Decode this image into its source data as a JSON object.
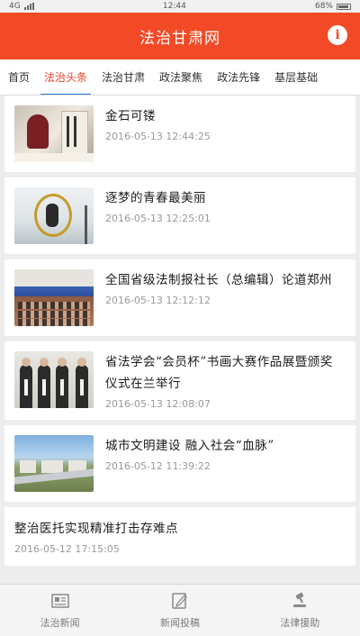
{
  "status_bar": {
    "network": "4G",
    "time": "12:44",
    "battery": "68%"
  },
  "header": {
    "title": "法治甘肃网",
    "info_icon": "info-icon",
    "info_label": "i",
    "background": "#f24a26"
  },
  "tabs": [
    {
      "label": "首页",
      "active": false
    },
    {
      "label": "法治头条",
      "active": true
    },
    {
      "label": "法治甘肃",
      "active": false
    },
    {
      "label": "政法聚焦",
      "active": false
    },
    {
      "label": "政法先锋",
      "active": false
    },
    {
      "label": "基层基础",
      "active": false
    }
  ],
  "news": [
    {
      "title": "金石可镂",
      "date": "2016-05-13 12:44:25",
      "has_image": true
    },
    {
      "title": "逐梦的青春最美丽",
      "date": "2016-05-13 12:25:01",
      "has_image": true
    },
    {
      "title": "全国省级法制报社长（总编辑）论道郑州",
      "date": "2016-05-13 12:12:12",
      "has_image": true
    },
    {
      "title": "省法学会“会员杯”书画大赛作品展暨颁奖仪式在兰举行",
      "date": "2016-05-13 12:08:07",
      "has_image": true
    },
    {
      "title": "城市文明建设 融入社会“血脉”",
      "date": "2016-05-12 11:39:22",
      "has_image": true
    },
    {
      "title": "整治医托实现精准打击存难点",
      "date": "2016-05-12 17:15:05",
      "has_image": false
    }
  ],
  "bottom_tabs": [
    {
      "label": "法治新闻",
      "icon": "newspaper-icon"
    },
    {
      "label": "新闻投稿",
      "icon": "edit-icon"
    },
    {
      "label": "法律援助",
      "icon": "gavel-icon"
    }
  ]
}
